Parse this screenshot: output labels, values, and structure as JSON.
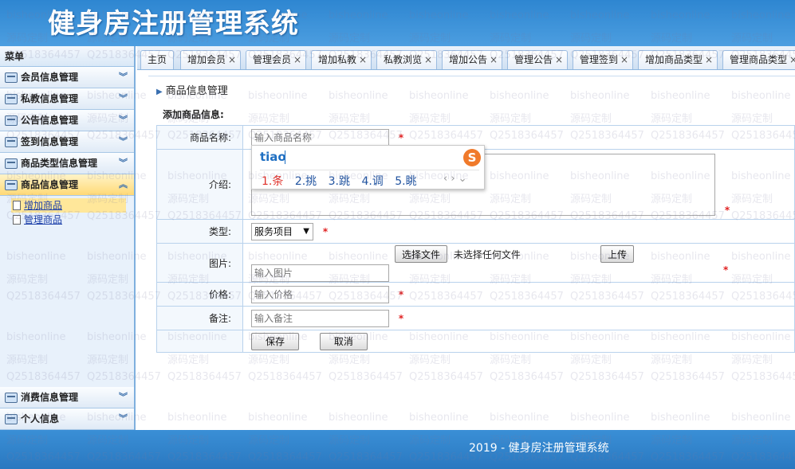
{
  "header": {
    "title": "健身房注册管理系统"
  },
  "sidebar": {
    "menu_title": "菜单",
    "groups": [
      {
        "label": "会员信息管理"
      },
      {
        "label": "私教信息管理"
      },
      {
        "label": "公告信息管理"
      },
      {
        "label": "签到信息管理"
      },
      {
        "label": "商品类型信息管理"
      },
      {
        "label": "商品信息管理"
      }
    ],
    "active_subitems": [
      {
        "label": "增加商品"
      },
      {
        "label": "管理商品"
      }
    ],
    "bottom_groups": [
      {
        "label": "消费信息管理"
      },
      {
        "label": "个人信息"
      }
    ]
  },
  "tabs": [
    {
      "label": "主页"
    },
    {
      "label": "增加会员"
    },
    {
      "label": "管理会员"
    },
    {
      "label": "增加私教"
    },
    {
      "label": "私教浏览"
    },
    {
      "label": "增加公告"
    },
    {
      "label": "管理公告"
    },
    {
      "label": "管理签到"
    },
    {
      "label": "增加商品类型"
    },
    {
      "label": "管理商品类型"
    }
  ],
  "tab_close_glyph": "×",
  "breadcrumb": "商品信息管理",
  "form": {
    "section_title": "添加商品信息:",
    "name": {
      "label": "商品名称:",
      "placeholder": "输入商品名称"
    },
    "intro": {
      "label": "介绍:"
    },
    "type": {
      "label": "类型:",
      "selected": "服务项目"
    },
    "image": {
      "label": "图片:",
      "choose_button": "选择文件",
      "no_file": "未选择任何文件",
      "upload_button": "上传",
      "placeholder": "输入图片"
    },
    "price": {
      "label": "价格:",
      "placeholder": "输入价格"
    },
    "remark": {
      "label": "备注:",
      "placeholder": "输入备注"
    },
    "required_mark": "*",
    "save_button": "保存",
    "cancel_button": "取消"
  },
  "ime": {
    "pinyin": "tiao",
    "logo": "S",
    "candidates": [
      "1.条",
      "2.挑",
      "3.跳",
      "4.调",
      "5.眺"
    ],
    "nav": "‹ ›  ⌄"
  },
  "footer": {
    "text": "2019 - 健身房注册管理系统"
  },
  "watermark": {
    "line1": "bisheonline",
    "line2": "源码定制",
    "line3": "Q2518364457"
  },
  "colors": {
    "header_bg": "#3a8fd6",
    "active_menu": "#ffd976",
    "required": "#e02020",
    "ime_accent": "#1f6fc2"
  }
}
